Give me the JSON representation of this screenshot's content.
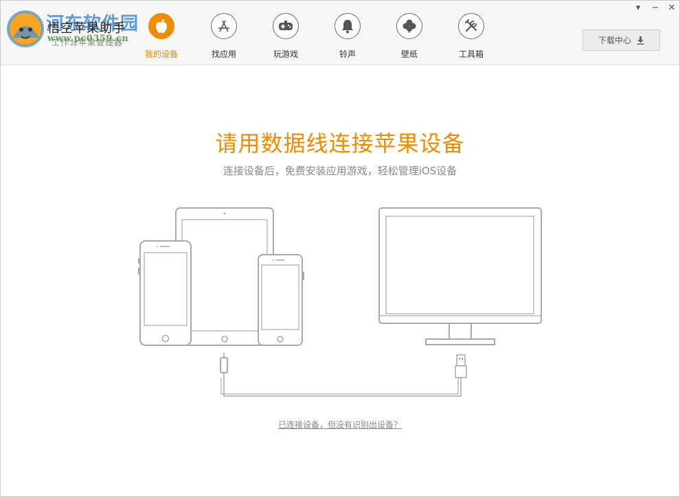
{
  "app": {
    "title": "悟空苹果助手",
    "subtitle": "工作公苹果管理器",
    "watermark_title": "河东软件园",
    "watermark_url": "www.pc0359.cn"
  },
  "nav": {
    "items": [
      {
        "label": "我的设备",
        "icon": "apple-icon",
        "active": true
      },
      {
        "label": "找应用",
        "icon": "app-store-icon",
        "active": false
      },
      {
        "label": "玩游戏",
        "icon": "gamepad-icon",
        "active": false
      },
      {
        "label": "铃声",
        "icon": "bell-icon",
        "active": false
      },
      {
        "label": "壁纸",
        "icon": "clover-icon",
        "active": false
      },
      {
        "label": "工具箱",
        "icon": "tools-icon",
        "active": false
      }
    ]
  },
  "window_controls": {
    "menu": "▾",
    "minimize": "−",
    "close": "✕"
  },
  "download": {
    "label": "下载中心",
    "icon": "download-icon"
  },
  "main": {
    "headline": "请用数据线连接苹果设备",
    "subline": "连接设备后，免费安装应用游戏，轻松管理iOS设备",
    "help_link": "已连接设备，但没有识别出设备？"
  },
  "colors": {
    "accent": "#f08c00",
    "outline": "#a9a9a9"
  }
}
